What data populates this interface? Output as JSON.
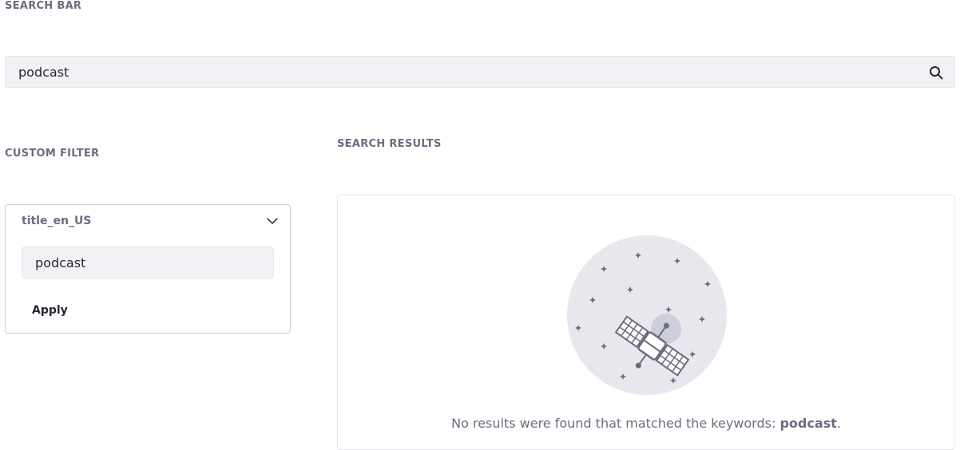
{
  "search_bar": {
    "heading": "SEARCH BAR",
    "value": "podcast",
    "search_icon": "search-icon"
  },
  "custom_filter": {
    "heading": "CUSTOM FILTER",
    "field_name": "title_en_US",
    "value": "podcast",
    "apply_label": "Apply",
    "toggle_icon": "chevron-down-icon"
  },
  "search_results": {
    "heading": "SEARCH RESULTS",
    "empty_message_prefix": "No results were found that matched the keywords: ",
    "empty_keyword": "podcast",
    "empty_message_suffix": ".",
    "illustration": "satellite-illustration"
  },
  "colors": {
    "text_primary": "#272833",
    "text_secondary": "#6b6c7e",
    "input_bg": "#f1f2f5",
    "border": "#cdced9",
    "illustration_circle": "#e7e7ed",
    "illustration_ink": "#6b6c7e"
  }
}
